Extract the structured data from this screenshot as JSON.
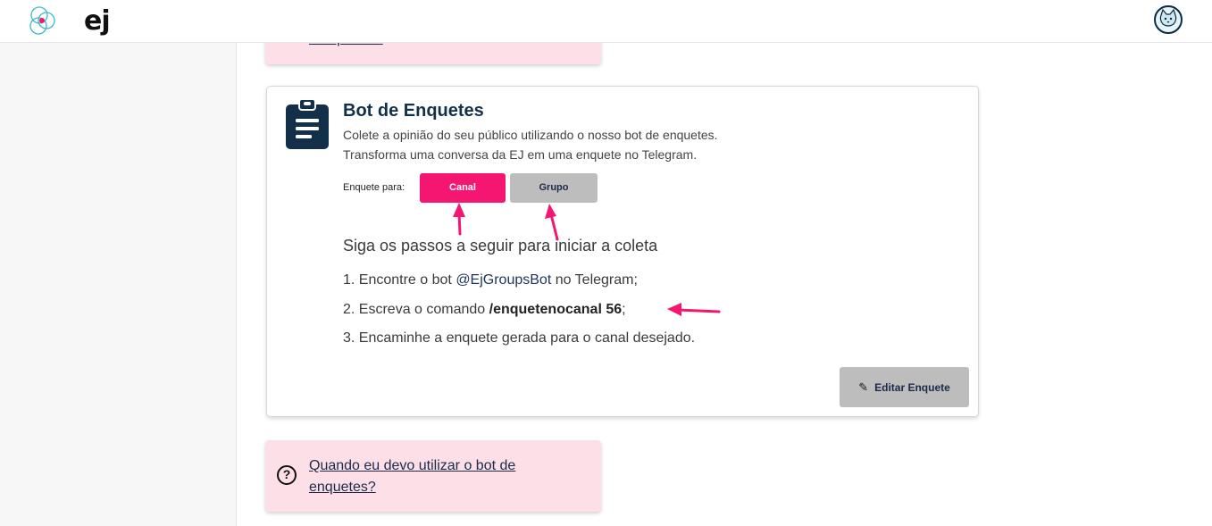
{
  "header": {
    "logo_text": "ej",
    "avatar_icon": "cat-avatar-icon"
  },
  "top_card": {
    "link_text": "de opinião?"
  },
  "bot_card": {
    "title": "Bot de Enquetes",
    "description_line1": "Colete a opinião do seu público utilizando o nosso bot de enquetes.",
    "description_line2": "Transforma uma conversa da EJ em uma enquete no Telegram.",
    "poll_for_label": "Enquete para:",
    "channel_button": "Canal",
    "group_button": "Grupo",
    "steps_title": "Siga os passos a seguir para iniciar a coleta",
    "step1_prefix": "1. Encontre o bot ",
    "step1_bot": "@EjGroupsBot",
    "step1_suffix": " no Telegram;",
    "step2_prefix": "2.  Escreva o comando ",
    "step2_command": "/enquetenocanal 56",
    "step2_suffix": ";",
    "step3": "3. Encaminhe a enquete gerada para o canal desejado.",
    "edit_button": "Editar Enquete"
  },
  "help_card": {
    "question_icon": "?",
    "link_text": "Quando eu devo utilizar o bot de enquetes?"
  },
  "colors": {
    "accent_pink": "#f51672",
    "navy": "#12304a",
    "gray_button": "#bdbdbd",
    "pink_card": "#fde0e7"
  }
}
